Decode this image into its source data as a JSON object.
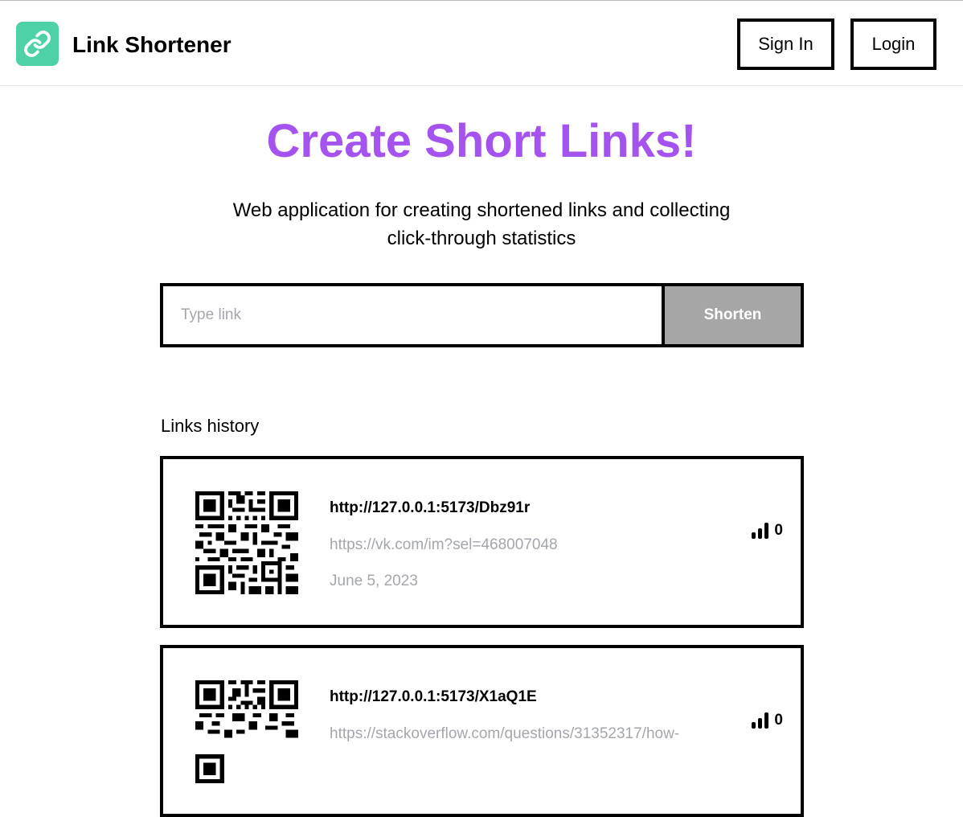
{
  "header": {
    "brand": "Link Shortener",
    "logo_icon": "link-icon",
    "accent_color": "#4fd1a7",
    "sign_in_label": "Sign In",
    "login_label": "Login"
  },
  "hero": {
    "title": "Create Short Links!",
    "title_color": "#a553ee",
    "subtitle_line1": "Web application for creating shortened links and collecting",
    "subtitle_line2": "click-through statistics"
  },
  "form": {
    "input_value": "",
    "input_placeholder": "Type link",
    "shorten_label": "Shorten"
  },
  "history": {
    "label": "Links history",
    "items": [
      {
        "short_url": "http://127.0.0.1:5173/Dbz91r",
        "original_url": "https://vk.com/im?sel=468007048",
        "date": "June 5, 2023",
        "clicks": "0",
        "qr_icon": "qr-code-icon",
        "stats_icon": "bar-chart-icon"
      },
      {
        "short_url": "http://127.0.0.1:5173/X1aQ1E",
        "original_url": "https://stackoverflow.com/questions/31352317/how-",
        "date": "",
        "clicks": "0",
        "qr_icon": "qr-code-icon",
        "stats_icon": "bar-chart-icon"
      }
    ]
  }
}
